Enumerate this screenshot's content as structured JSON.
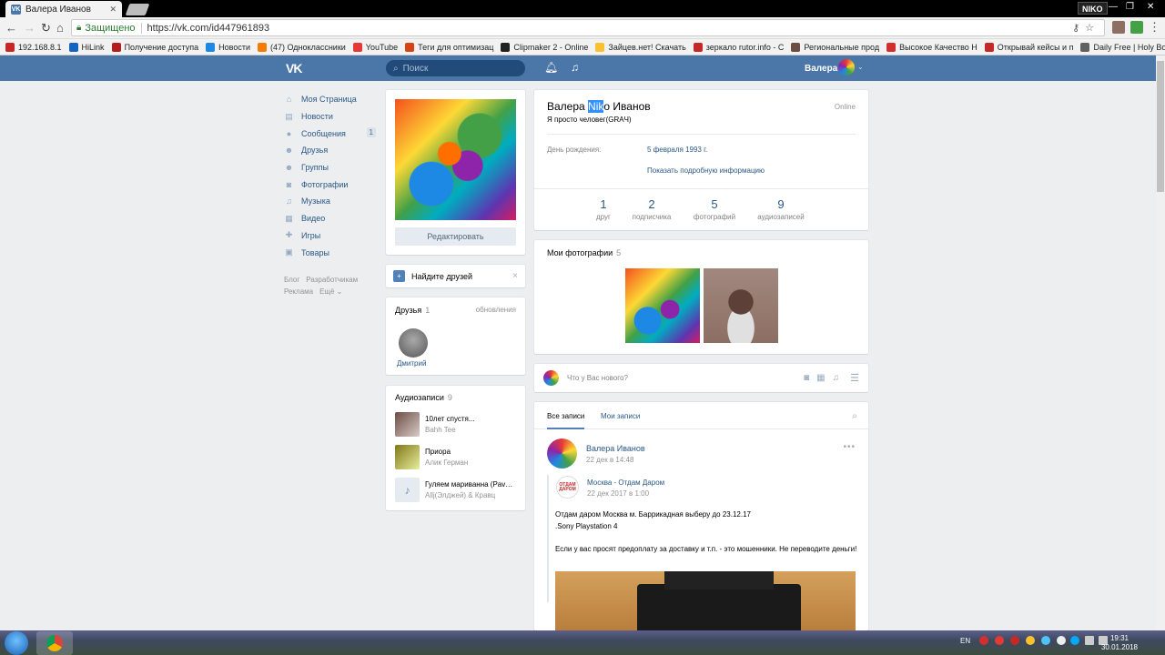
{
  "browser": {
    "tab_title": "Валера Иванов",
    "profile_chip": "NIKO",
    "secure_label": "Защищено",
    "url": "https://vk.com/id447961893",
    "bookmarks": [
      {
        "label": "192.168.8.1",
        "color": "#c62828"
      },
      {
        "label": "HiLink",
        "color": "#1565c0"
      },
      {
        "label": "Получение доступа",
        "color": "#b71c1c"
      },
      {
        "label": "Новости",
        "color": "#1e88e5"
      },
      {
        "label": "(47) Одноклассники",
        "color": "#f57c00"
      },
      {
        "label": "YouTube",
        "color": "#e53935"
      },
      {
        "label": "Теги для оптимизац",
        "color": "#d84315"
      },
      {
        "label": "Clipmaker 2 - Online",
        "color": "#212121"
      },
      {
        "label": "Зайцев.нет! Скачать",
        "color": "#fbc02d"
      },
      {
        "label": "зеркало rutor.info - С",
        "color": "#c62828"
      },
      {
        "label": "Региональные прод",
        "color": "#6d4c41"
      },
      {
        "label": "Высокое Качество Н",
        "color": "#d32f2f"
      },
      {
        "label": "Открывай кейсы и п",
        "color": "#c62828"
      },
      {
        "label": "Daily Free | Holy Boo",
        "color": "#616161"
      }
    ]
  },
  "vk_header": {
    "logo": "VK",
    "search_placeholder": "Поиск",
    "user_name": "Валера"
  },
  "left_menu": {
    "items": [
      {
        "label": "Моя Страница",
        "icon": "home-icon",
        "glyph": "⌂"
      },
      {
        "label": "Новости",
        "icon": "news-icon",
        "glyph": "▤"
      },
      {
        "label": "Сообщения",
        "icon": "messages-icon",
        "glyph": "●",
        "count": "1"
      },
      {
        "label": "Друзья",
        "icon": "friends-icon",
        "glyph": "☻"
      },
      {
        "label": "Группы",
        "icon": "groups-icon",
        "glyph": "☻"
      },
      {
        "label": "Фотографии",
        "icon": "camera-icon",
        "glyph": "◙"
      },
      {
        "label": "Музыка",
        "icon": "music-icon",
        "glyph": "♫"
      },
      {
        "label": "Видео",
        "icon": "video-icon",
        "glyph": "▦"
      },
      {
        "label": "Игры",
        "icon": "games-icon",
        "glyph": "✚"
      },
      {
        "label": "Товары",
        "icon": "goods-icon",
        "glyph": "▣"
      }
    ],
    "footer": [
      "Блог",
      "Разработчикам",
      "Реклама",
      "Ещё ⌄"
    ]
  },
  "profile_card": {
    "edit_label": "Редактировать"
  },
  "find_friends": {
    "label": "Найдите друзей",
    "close": "×"
  },
  "friends_block": {
    "title": "Друзья",
    "count": "1",
    "updates_label": "обновления",
    "friend_name": "Дмитрий"
  },
  "audio_block": {
    "title": "Аудиозаписи",
    "count": "9",
    "tracks": [
      {
        "title": "10лет спустя...",
        "artist": "Bahh Tee"
      },
      {
        "title": "Приора",
        "artist": "Алик Герман"
      },
      {
        "title": "Гуляем мариванна (Pav…",
        "artist": "Allj(Элджей) & Кравц"
      }
    ]
  },
  "profile_info": {
    "name_before": "Валера ",
    "name_selected": "Nik",
    "name_after": "o Иванов",
    "status": "Я просто человег(GRAЧ)",
    "online": "Online",
    "birthday_label": "День рождения:",
    "birthday_value": "5 февраля 1993 г.",
    "more_info": "Показать подробную информацию",
    "counters": [
      {
        "num": "1",
        "label": "друг"
      },
      {
        "num": "2",
        "label": "подписчика"
      },
      {
        "num": "5",
        "label": "фотографий"
      },
      {
        "num": "9",
        "label": "аудиозаписей"
      }
    ]
  },
  "photos_block": {
    "title": "Мои фотографии",
    "count": "5"
  },
  "post_input": {
    "placeholder": "Что у Вас нового?"
  },
  "wall": {
    "tabs": [
      "Все записи",
      "Мои записи"
    ],
    "post": {
      "author": "Валера Иванов",
      "date": "22 дек в 14:48",
      "repost_source": "Москва - Отдам Даром",
      "repost_logo": "ОТДАМ ДАРОМ",
      "repost_date": "22 дек 2017 в 1:00",
      "text1": "Отдам даром Москва м. Баррикадная выберу до 23.12.17",
      "text2": ".Sony Playstation 4",
      "text3": "Если у вас просят предоплату за доставку и т.п. - это мошенники. Не переводите деньги!"
    }
  },
  "taskbar": {
    "lang": "EN",
    "time": "19:31",
    "date": "30.01.2018"
  }
}
